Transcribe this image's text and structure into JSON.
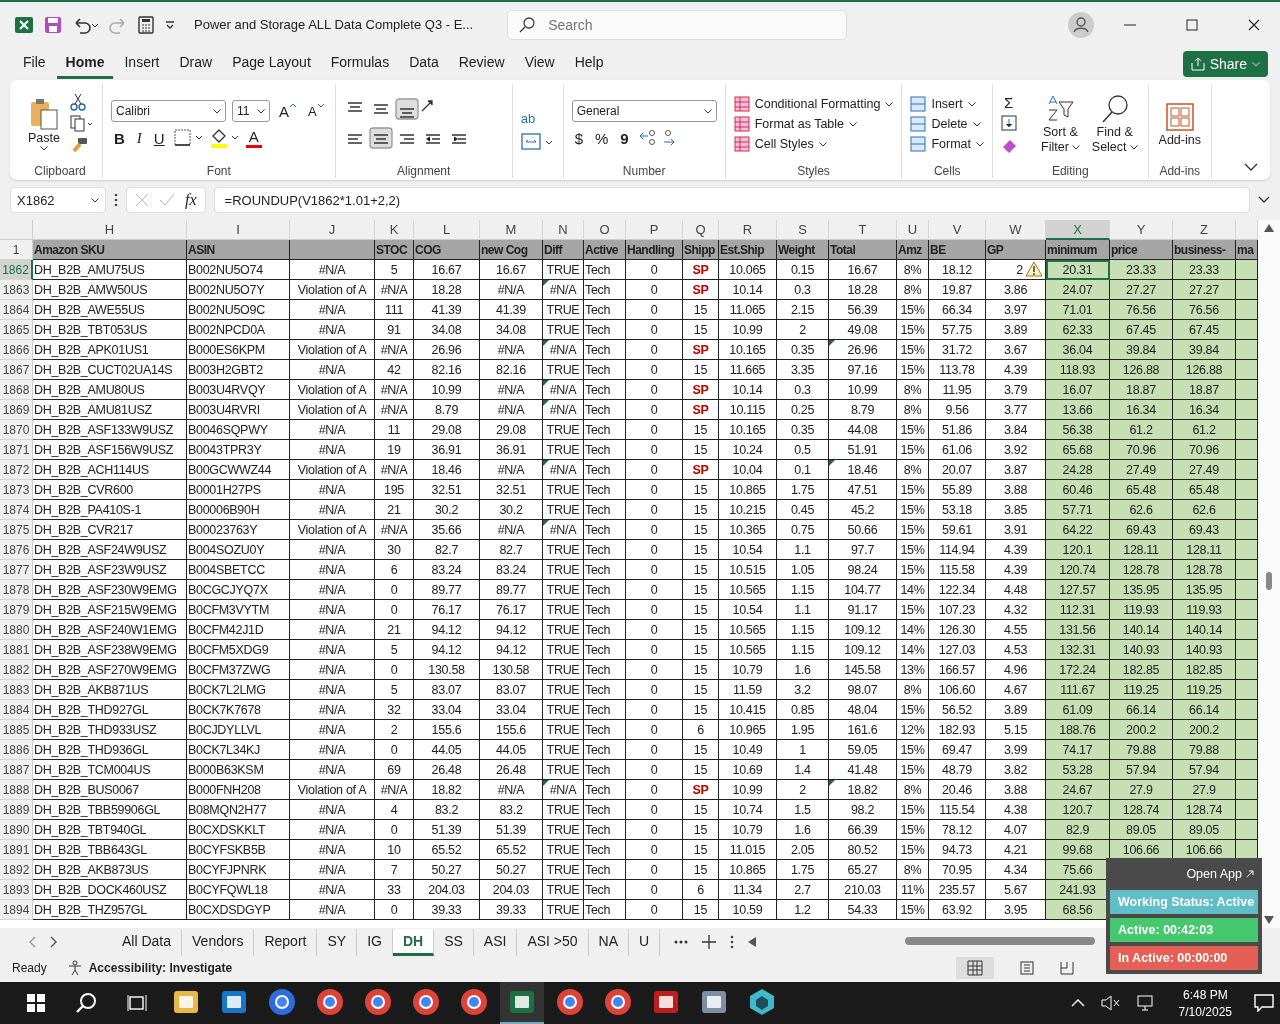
{
  "window": {
    "title": "Power and Storage ALL Data Complete Q3  -  E...",
    "search_placeholder": "Search"
  },
  "menu": [
    {
      "label": "File",
      "selected": false
    },
    {
      "label": "Home",
      "selected": true
    },
    {
      "label": "Insert",
      "selected": false
    },
    {
      "label": "Draw",
      "selected": false
    },
    {
      "label": "Page Layout",
      "selected": false
    },
    {
      "label": "Formulas",
      "selected": false
    },
    {
      "label": "Data",
      "selected": false
    },
    {
      "label": "Review",
      "selected": false
    },
    {
      "label": "View",
      "selected": false
    },
    {
      "label": "Help",
      "selected": false
    }
  ],
  "share": "Share",
  "ribbon": {
    "paste": "Paste",
    "font_name": "Calibri",
    "font_size": "11",
    "grow": "A",
    "shrink": "A",
    "bold": "B",
    "italic": "I",
    "underline": "U",
    "font_color": "A",
    "wrap": "ab",
    "number_format": "General",
    "currency": "$",
    "percent": "%",
    "comma": "9",
    "styles": [
      "Conditional Formatting",
      "Format as Table",
      "Cell Styles"
    ],
    "cells": [
      "Insert",
      "Delete",
      "Format"
    ],
    "sum": "Σ",
    "sort": [
      "Sort &",
      "Filter"
    ],
    "find": [
      "Find &",
      "Select"
    ],
    "addins": "Add-ins",
    "groups": [
      "Clipboard",
      "Font",
      "Alignment",
      "Number",
      "Styles",
      "Cells",
      "Editing",
      "Add-ins"
    ]
  },
  "formula_bar": {
    "name_box": "X1862",
    "fx": "fx",
    "formula": "=ROUNDUP(V1862*1.01+2,2)"
  },
  "columns": [
    {
      "letter": "H",
      "header": "Amazon SKU",
      "selected": false
    },
    {
      "letter": "I",
      "header": "ASIN",
      "selected": false
    },
    {
      "letter": "J",
      "selected": false
    },
    {
      "letter": "K",
      "header": "STOC",
      "selected": false
    },
    {
      "letter": "L",
      "header": "COG",
      "selected": false
    },
    {
      "letter": "M",
      "header": "new Cog",
      "selected": false
    },
    {
      "letter": "N",
      "header": "Diff",
      "selected": false
    },
    {
      "letter": "O",
      "header": "Active",
      "selected": false
    },
    {
      "letter": "P",
      "header": "Handling",
      "selected": false
    },
    {
      "letter": "Q",
      "header": "Shipp",
      "selected": false
    },
    {
      "letter": "R",
      "header": "Est.Ship",
      "selected": false
    },
    {
      "letter": "S",
      "header": "Weight",
      "selected": false
    },
    {
      "letter": "T",
      "header": "Total",
      "selected": false
    },
    {
      "letter": "U",
      "header": "Amz",
      "selected": false
    },
    {
      "letter": "V",
      "header": "BE",
      "selected": false
    },
    {
      "letter": "W",
      "header": "GP",
      "selected": false
    },
    {
      "letter": "X",
      "header": "minimum",
      "selected": true
    },
    {
      "letter": "Y",
      "header": "price",
      "selected": false
    },
    {
      "letter": "Z",
      "header": "business-",
      "selected": false
    },
    {
      "header": "ma",
      "selected": false
    }
  ],
  "header_row": "1",
  "rows": [
    {
      "row": "1862",
      "selected": true,
      "ship_flag": true,
      "diff_error": false,
      "total_error": false,
      "warning": true,
      "cells": [
        "DH_B2B_AMU75US",
        "B002NU5O74",
        "#N/A",
        "5",
        "16.67",
        "16.67",
        "TRUE",
        "Tech",
        "0",
        "SP",
        "10.065",
        "0.15",
        "16.67",
        "8%",
        "18.12",
        "2",
        "20.31",
        "23.33",
        "23.33"
      ]
    },
    {
      "row": "1863",
      "selected": false,
      "ship_flag": true,
      "diff_error": true,
      "total_error": false,
      "warning": false,
      "cells": [
        "DH_B2B_AMW50US",
        "B002NU5O7Y",
        "Violation of A",
        "#N/A",
        "18.28",
        "#N/A",
        "#N/A",
        "Tech",
        "0",
        "SP",
        "10.14",
        "0.3",
        "18.28",
        "8%",
        "19.87",
        "3.86",
        "24.07",
        "27.27",
        "27.27"
      ]
    },
    {
      "row": "1864",
      "selected": false,
      "ship_flag": false,
      "diff_error": false,
      "total_error": false,
      "warning": false,
      "cells": [
        "DH_B2B_AWE55US",
        "B002NU5O9C",
        "#N/A",
        "111",
        "41.39",
        "41.39",
        "TRUE",
        "Tech",
        "0",
        "15",
        "11.065",
        "2.15",
        "56.39",
        "15%",
        "66.34",
        "3.97",
        "71.01",
        "76.56",
        "76.56"
      ]
    },
    {
      "row": "1865",
      "selected": false,
      "ship_flag": false,
      "diff_error": false,
      "total_error": false,
      "warning": false,
      "cells": [
        "DH_B2B_TBT053US",
        "B002NPCD0A",
        "#N/A",
        "91",
        "34.08",
        "34.08",
        "TRUE",
        "Tech",
        "0",
        "15",
        "10.99",
        "2",
        "49.08",
        "15%",
        "57.75",
        "3.89",
        "62.33",
        "67.45",
        "67.45"
      ]
    },
    {
      "row": "1866",
      "selected": false,
      "ship_flag": true,
      "diff_error": true,
      "total_error": true,
      "warning": false,
      "cells": [
        "DH_B2B_APK01US1",
        "B000ES6KPM",
        "Violation of A",
        "#N/A",
        "26.96",
        "#N/A",
        "#N/A",
        "Tech",
        "0",
        "SP",
        "10.165",
        "0.35",
        "26.96",
        "15%",
        "31.72",
        "3.67",
        "36.04",
        "39.84",
        "39.84"
      ]
    },
    {
      "row": "1867",
      "selected": false,
      "ship_flag": false,
      "diff_error": false,
      "total_error": false,
      "warning": false,
      "cells": [
        "DH_B2B_CUCT02UA14S",
        "B003H2GBT2",
        "#N/A",
        "42",
        "82.16",
        "82.16",
        "TRUE",
        "Tech",
        "0",
        "15",
        "11.665",
        "3.35",
        "97.16",
        "15%",
        "113.78",
        "4.39",
        "118.93",
        "126.88",
        "126.88"
      ]
    },
    {
      "row": "1868",
      "selected": false,
      "ship_flag": true,
      "diff_error": true,
      "total_error": false,
      "warning": false,
      "cells": [
        "DH_B2B_AMU80US",
        "B003U4RVQY",
        "Violation of A",
        "#N/A",
        "10.99",
        "#N/A",
        "#N/A",
        "Tech",
        "0",
        "SP",
        "10.14",
        "0.3",
        "10.99",
        "8%",
        "11.95",
        "3.79",
        "16.07",
        "18.87",
        "18.87"
      ]
    },
    {
      "row": "1869",
      "selected": false,
      "ship_flag": true,
      "diff_error": true,
      "total_error": false,
      "warning": false,
      "cells": [
        "DH_B2B_AMU81USZ",
        "B003U4RVRI",
        "Violation of A",
        "#N/A",
        "8.79",
        "#N/A",
        "#N/A",
        "Tech",
        "0",
        "SP",
        "10.115",
        "0.25",
        "8.79",
        "8%",
        "9.56",
        "3.77",
        "13.66",
        "16.34",
        "16.34"
      ]
    },
    {
      "row": "1870",
      "selected": false,
      "ship_flag": false,
      "diff_error": false,
      "total_error": false,
      "warning": false,
      "cells": [
        "DH_B2B_ASF133W9USZ",
        "B0046SQPWY",
        "#N/A",
        "11",
        "29.08",
        "29.08",
        "TRUE",
        "Tech",
        "0",
        "15",
        "10.165",
        "0.35",
        "44.08",
        "15%",
        "51.86",
        "3.84",
        "56.38",
        "61.2",
        "61.2"
      ]
    },
    {
      "row": "1871",
      "selected": false,
      "ship_flag": false,
      "diff_error": false,
      "total_error": false,
      "warning": false,
      "cells": [
        "DH_B2B_ASF156W9USZ",
        "B0043TPR3Y",
        "#N/A",
        "19",
        "36.91",
        "36.91",
        "TRUE",
        "Tech",
        "0",
        "15",
        "10.24",
        "0.5",
        "51.91",
        "15%",
        "61.06",
        "3.92",
        "65.68",
        "70.96",
        "70.96"
      ]
    },
    {
      "row": "1872",
      "selected": false,
      "ship_flag": true,
      "diff_error": true,
      "total_error": true,
      "warning": false,
      "cells": [
        "DH_B2B_ACH114US",
        "B00GCWWZ44",
        "Violation of A",
        "#N/A",
        "18.46",
        "#N/A",
        "#N/A",
        "Tech",
        "0",
        "SP",
        "10.04",
        "0.1",
        "18.46",
        "8%",
        "20.07",
        "3.87",
        "24.28",
        "27.49",
        "27.49"
      ]
    },
    {
      "row": "1873",
      "selected": false,
      "ship_flag": false,
      "diff_error": false,
      "total_error": false,
      "warning": false,
      "cells": [
        "DH_B2B_CVR600",
        "B0001H27PS",
        "#N/A",
        "195",
        "32.51",
        "32.51",
        "TRUE",
        "Tech",
        "0",
        "15",
        "10.865",
        "1.75",
        "47.51",
        "15%",
        "55.89",
        "3.88",
        "60.46",
        "65.48",
        "65.48"
      ]
    },
    {
      "row": "1874",
      "selected": false,
      "ship_flag": false,
      "diff_error": false,
      "total_error": false,
      "warning": false,
      "cells": [
        "DH_B2B_PA410S-1",
        "B00006B90H",
        "#N/A",
        "21",
        "30.2",
        "30.2",
        "TRUE",
        "Tech",
        "0",
        "15",
        "10.215",
        "0.45",
        "45.2",
        "15%",
        "53.18",
        "3.85",
        "57.71",
        "62.6",
        "62.6"
      ]
    },
    {
      "row": "1875",
      "selected": false,
      "ship_flag": false,
      "diff_error": true,
      "total_error": false,
      "warning": false,
      "cells": [
        "DH_B2B_CVR217",
        "B00023763Y",
        "Violation of A",
        "#N/A",
        "35.66",
        "#N/A",
        "#N/A",
        "Tech",
        "0",
        "15",
        "10.365",
        "0.75",
        "50.66",
        "15%",
        "59.61",
        "3.91",
        "64.22",
        "69.43",
        "69.43"
      ]
    },
    {
      "row": "1876",
      "selected": false,
      "ship_flag": false,
      "diff_error": false,
      "total_error": false,
      "warning": false,
      "cells": [
        "DH_B2B_ASF24W9USZ",
        "B004SOZU0Y",
        "#N/A",
        "30",
        "82.7",
        "82.7",
        "TRUE",
        "Tech",
        "0",
        "15",
        "10.54",
        "1.1",
        "97.7",
        "15%",
        "114.94",
        "4.39",
        "120.1",
        "128.11",
        "128.11"
      ]
    },
    {
      "row": "1877",
      "selected": false,
      "ship_flag": false,
      "diff_error": false,
      "total_error": false,
      "warning": false,
      "cells": [
        "DH_B2B_ASF23W9USZ",
        "B004SBETCC",
        "#N/A",
        "6",
        "83.24",
        "83.24",
        "TRUE",
        "Tech",
        "0",
        "15",
        "10.515",
        "1.05",
        "98.24",
        "15%",
        "115.58",
        "4.39",
        "120.74",
        "128.78",
        "128.78"
      ]
    },
    {
      "row": "1878",
      "selected": false,
      "ship_flag": false,
      "diff_error": false,
      "total_error": false,
      "warning": false,
      "cells": [
        "DH_B2B_ASF230W9EMG",
        "B0CGCJYQ7X",
        "#N/A",
        "0",
        "89.77",
        "89.77",
        "TRUE",
        "Tech",
        "0",
        "15",
        "10.565",
        "1.15",
        "104.77",
        "14%",
        "122.34",
        "4.48",
        "127.57",
        "135.95",
        "135.95"
      ]
    },
    {
      "row": "1879",
      "selected": false,
      "ship_flag": false,
      "diff_error": false,
      "total_error": false,
      "warning": false,
      "cells": [
        "DH_B2B_ASF215W9EMG",
        "B0CFM3VYTM",
        "#N/A",
        "0",
        "76.17",
        "76.17",
        "TRUE",
        "Tech",
        "0",
        "15",
        "10.54",
        "1.1",
        "91.17",
        "15%",
        "107.23",
        "4.32",
        "112.31",
        "119.93",
        "119.93"
      ]
    },
    {
      "row": "1880",
      "selected": false,
      "ship_flag": false,
      "diff_error": false,
      "total_error": false,
      "warning": false,
      "cells": [
        "DH_B2B_ASF240W1EMG",
        "B0CFM42J1D",
        "#N/A",
        "21",
        "94.12",
        "94.12",
        "TRUE",
        "Tech",
        "0",
        "15",
        "10.565",
        "1.15",
        "109.12",
        "14%",
        "126.30",
        "4.55",
        "131.56",
        "140.14",
        "140.14"
      ]
    },
    {
      "row": "1881",
      "selected": false,
      "ship_flag": false,
      "diff_error": false,
      "total_error": false,
      "warning": false,
      "cells": [
        "DH_B2B_ASF238W9EMG",
        "B0CFM5XDG9",
        "#N/A",
        "5",
        "94.12",
        "94.12",
        "TRUE",
        "Tech",
        "0",
        "15",
        "10.565",
        "1.15",
        "109.12",
        "14%",
        "127.03",
        "4.53",
        "132.31",
        "140.93",
        "140.93"
      ]
    },
    {
      "row": "1882",
      "selected": false,
      "ship_flag": false,
      "diff_error": false,
      "total_error": false,
      "warning": false,
      "cells": [
        "DH_B2B_ASF270W9EMG",
        "B0CFM37ZWG",
        "#N/A",
        "0",
        "130.58",
        "130.58",
        "TRUE",
        "Tech",
        "0",
        "15",
        "10.79",
        "1.6",
        "145.58",
        "13%",
        "166.57",
        "4.96",
        "172.24",
        "182.85",
        "182.85"
      ]
    },
    {
      "row": "1883",
      "selected": false,
      "ship_flag": false,
      "diff_error": false,
      "total_error": false,
      "warning": false,
      "cells": [
        "DH_B2B_AKB871US",
        "B0CK7L2LMG",
        "#N/A",
        "5",
        "83.07",
        "83.07",
        "TRUE",
        "Tech",
        "0",
        "15",
        "11.59",
        "3.2",
        "98.07",
        "8%",
        "106.60",
        "4.67",
        "111.67",
        "119.25",
        "119.25"
      ]
    },
    {
      "row": "1884",
      "selected": false,
      "ship_flag": false,
      "diff_error": false,
      "total_error": false,
      "warning": false,
      "cells": [
        "DH_B2B_THD927GL",
        "B0CK7K7678",
        "#N/A",
        "32",
        "33.04",
        "33.04",
        "TRUE",
        "Tech",
        "0",
        "15",
        "10.415",
        "0.85",
        "48.04",
        "15%",
        "56.52",
        "3.89",
        "61.09",
        "66.14",
        "66.14"
      ]
    },
    {
      "row": "1885",
      "selected": false,
      "ship_flag": false,
      "diff_error": false,
      "total_error": false,
      "warning": false,
      "cells": [
        "DH_B2B_THD933USZ",
        "B0CJDYLLVL",
        "#N/A",
        "2",
        "155.6",
        "155.6",
        "TRUE",
        "Tech",
        "0",
        "6",
        "10.965",
        "1.95",
        "161.6",
        "12%",
        "182.93",
        "5.15",
        "188.76",
        "200.2",
        "200.2"
      ]
    },
    {
      "row": "1886",
      "selected": false,
      "ship_flag": false,
      "diff_error": false,
      "total_error": false,
      "warning": false,
      "cells": [
        "DH_B2B_THD936GL",
        "B0CK7L34KJ",
        "#N/A",
        "0",
        "44.05",
        "44.05",
        "TRUE",
        "Tech",
        "0",
        "15",
        "10.49",
        "1",
        "59.05",
        "15%",
        "69.47",
        "3.99",
        "74.17",
        "79.88",
        "79.88"
      ]
    },
    {
      "row": "1887",
      "selected": false,
      "ship_flag": false,
      "diff_error": false,
      "total_error": false,
      "warning": false,
      "cells": [
        "DH_B2B_TCM004US",
        "B000B63KSM",
        "#N/A",
        "69",
        "26.48",
        "26.48",
        "TRUE",
        "Tech",
        "0",
        "15",
        "10.69",
        "1.4",
        "41.48",
        "15%",
        "48.79",
        "3.82",
        "53.28",
        "57.94",
        "57.94"
      ]
    },
    {
      "row": "1888",
      "selected": false,
      "ship_flag": true,
      "diff_error": true,
      "total_error": true,
      "warning": false,
      "cells": [
        "DH_B2B_BUS0067",
        "B000FNH208",
        "Violation of A",
        "#N/A",
        "18.82",
        "#N/A",
        "#N/A",
        "Tech",
        "0",
        "SP",
        "10.99",
        "2",
        "18.82",
        "8%",
        "20.46",
        "3.88",
        "24.67",
        "27.9",
        "27.9"
      ]
    },
    {
      "row": "1889",
      "selected": false,
      "ship_flag": false,
      "diff_error": false,
      "total_error": false,
      "warning": false,
      "cells": [
        "DH_B2B_TBB59906GL",
        "B08MQN2H77",
        "#N/A",
        "4",
        "83.2",
        "83.2",
        "TRUE",
        "Tech",
        "0",
        "15",
        "10.74",
        "1.5",
        "98.2",
        "15%",
        "115.54",
        "4.38",
        "120.7",
        "128.74",
        "128.74"
      ]
    },
    {
      "row": "1890",
      "selected": false,
      "ship_flag": false,
      "diff_error": false,
      "total_error": false,
      "warning": false,
      "cells": [
        "DH_B2B_TBT940GL",
        "B0CXDSKKLT",
        "#N/A",
        "0",
        "51.39",
        "51.39",
        "TRUE",
        "Tech",
        "0",
        "15",
        "10.79",
        "1.6",
        "66.39",
        "15%",
        "78.12",
        "4.07",
        "82.9",
        "89.05",
        "89.05"
      ]
    },
    {
      "row": "1891",
      "selected": false,
      "ship_flag": false,
      "diff_error": false,
      "total_error": false,
      "warning": false,
      "cells": [
        "DH_B2B_TBB643GL",
        "B0CYFSKB5B",
        "#N/A",
        "10",
        "65.52",
        "65.52",
        "TRUE",
        "Tech",
        "0",
        "15",
        "11.015",
        "2.05",
        "80.52",
        "15%",
        "94.73",
        "4.21",
        "99.68",
        "106.66",
        "106.66"
      ]
    },
    {
      "row": "1892",
      "selected": false,
      "ship_flag": false,
      "diff_error": false,
      "total_error": false,
      "warning": false,
      "cells": [
        "DH_B2B_AKB873US",
        "B0CYFJPNRK",
        "#N/A",
        "7",
        "50.27",
        "50.27",
        "TRUE",
        "Tech",
        "0",
        "15",
        "10.865",
        "1.75",
        "65.27",
        "8%",
        "70.95",
        "4.34",
        "75.66",
        null,
        null
      ]
    },
    {
      "row": "1893",
      "selected": false,
      "ship_flag": false,
      "diff_error": false,
      "total_error": false,
      "warning": false,
      "cells": [
        "DH_B2B_DOCK460USZ",
        "B0CYFQWL18",
        "#N/A",
        "33",
        "204.03",
        "204.03",
        "TRUE",
        "Tech",
        "0",
        "6",
        "11.34",
        "2.7",
        "210.03",
        "11%",
        "235.57",
        "5.67",
        "241.93",
        null,
        null
      ]
    },
    {
      "row": "1894",
      "selected": false,
      "ship_flag": false,
      "diff_error": false,
      "total_error": false,
      "warning": false,
      "cells": [
        "DH_B2B_THZ957GL",
        "B0CXDSDGYP",
        "#N/A",
        "0",
        "39.33",
        "39.33",
        "TRUE",
        "Tech",
        "0",
        "15",
        "10.59",
        "1.2",
        "54.33",
        "15%",
        "63.92",
        "3.95",
        "68.56",
        null,
        null
      ]
    }
  ],
  "sheets": [
    {
      "label": "All Data",
      "selected": false
    },
    {
      "label": "Vendors",
      "selected": false
    },
    {
      "label": "Report",
      "selected": false
    },
    {
      "label": "SY",
      "selected": false
    },
    {
      "label": "IG",
      "selected": false
    },
    {
      "label": "DH",
      "selected": true
    },
    {
      "label": "SS",
      "selected": false
    },
    {
      "label": "ASI",
      "selected": false
    },
    {
      "label": "ASI >50",
      "selected": false
    },
    {
      "label": "NA",
      "selected": false
    },
    {
      "label": "U",
      "selected": false
    }
  ],
  "status": {
    "ready": "Ready",
    "accessibility": "Accessibility: Investigate"
  },
  "tracker": {
    "open": "Open App",
    "working": "Working Status: Active",
    "active": "Active: 00:42:03",
    "inactive": "In Active: 00:00:00"
  },
  "taskbar": {
    "time": "6:48 PM",
    "date": "7/10/2025",
    "apps": [
      {
        "kind": "folder",
        "selected": false
      },
      {
        "kind": "outlook",
        "selected": false
      },
      {
        "kind": "zoom",
        "selected": false
      },
      {
        "kind": "chrome",
        "selected": false
      },
      {
        "kind": "chrome",
        "selected": false
      },
      {
        "kind": "chrome",
        "selected": false
      },
      {
        "kind": "chrome",
        "selected": false
      },
      {
        "kind": "excel",
        "selected": true
      },
      {
        "kind": "chrome",
        "selected": false
      },
      {
        "kind": "chrome",
        "selected": false
      },
      {
        "kind": "filezilla",
        "selected": false
      },
      {
        "kind": "calculator",
        "selected": false
      },
      {
        "kind": "hexagon",
        "selected": false
      }
    ]
  }
}
